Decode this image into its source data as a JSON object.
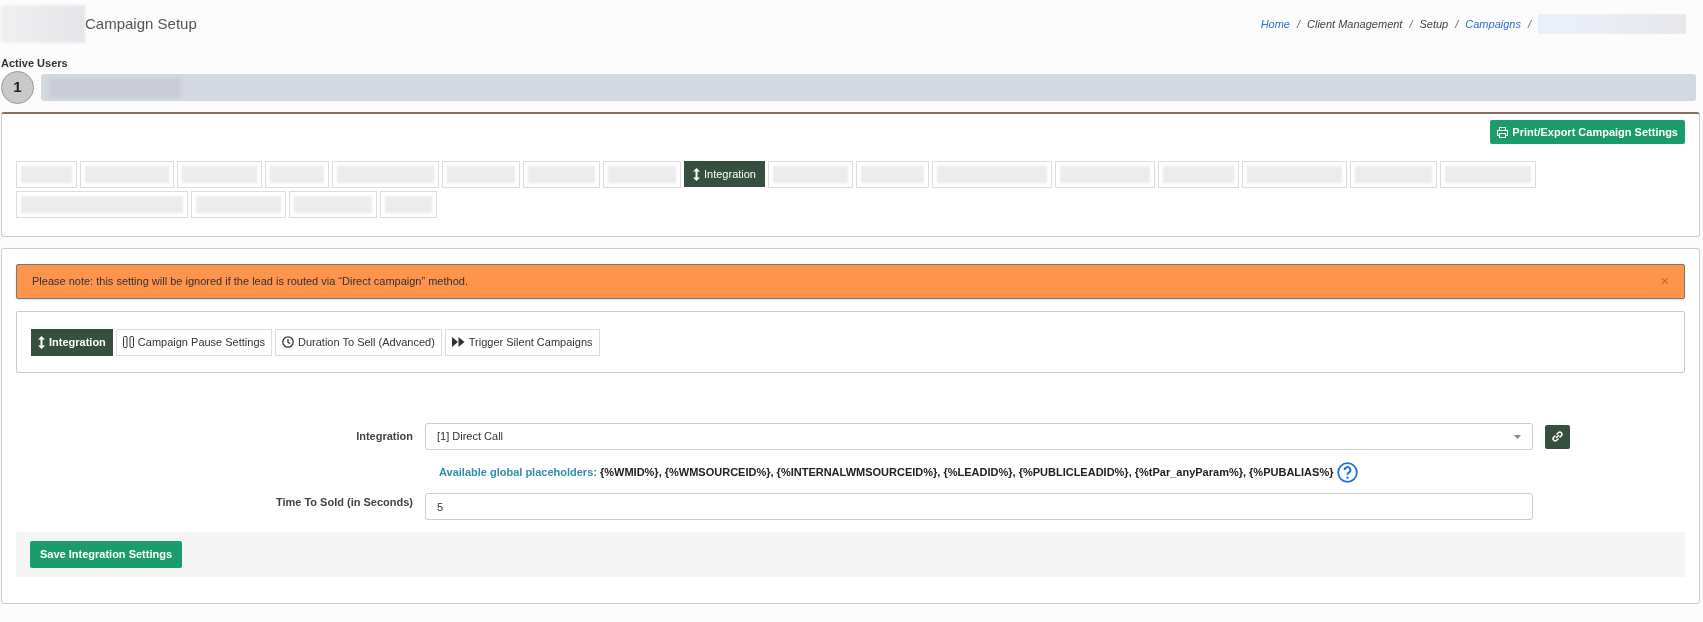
{
  "page": {
    "title": "Campaign Setup"
  },
  "breadcrumb": [
    {
      "label": "Home",
      "link": true,
      "separator": "/"
    },
    {
      "label": "Client Management",
      "link": false,
      "separator": "/"
    },
    {
      "label": "Setup",
      "link": false,
      "separator": "/"
    },
    {
      "label": "Campaigns",
      "link": true,
      "separator": "/"
    }
  ],
  "active_users": {
    "label": "Active Users",
    "count": "1"
  },
  "print_button": "Print/Export Campaign Settings",
  "campaign_tabs": [
    {
      "kind": "redacted",
      "selected": false
    },
    {
      "kind": "redacted",
      "selected": false
    },
    {
      "kind": "redacted",
      "selected": false
    },
    {
      "kind": "redacted",
      "selected": false
    },
    {
      "kind": "redacted",
      "selected": false
    },
    {
      "kind": "redacted",
      "selected": false
    },
    {
      "kind": "redacted",
      "selected": false
    },
    {
      "kind": "redacted",
      "selected": false
    },
    {
      "kind": "labeled",
      "label": "Integration",
      "selected": true
    },
    {
      "kind": "redacted",
      "selected": false
    },
    {
      "kind": "redacted",
      "selected": false
    },
    {
      "kind": "redacted",
      "selected": false
    },
    {
      "kind": "redacted",
      "selected": false
    },
    {
      "kind": "redacted",
      "selected": false
    },
    {
      "kind": "redacted",
      "selected": false
    },
    {
      "kind": "redacted",
      "selected": false
    },
    {
      "kind": "redacted",
      "selected": false
    },
    {
      "kind": "redacted",
      "selected": false
    },
    {
      "kind": "redacted",
      "selected": false
    },
    {
      "kind": "redacted",
      "selected": false
    },
    {
      "kind": "redacted",
      "selected": false
    }
  ],
  "alert": {
    "text": "Please note: this setting will be ignored if the lead is routed via “Direct campaign” method.",
    "close": "×"
  },
  "sub_tabs": [
    {
      "kind": "updown",
      "label": "Integration",
      "selected": true
    },
    {
      "kind": "pause",
      "label": "Campaign Pause Settings",
      "selected": false
    },
    {
      "kind": "clock",
      "label": "Duration To Sell (Advanced)",
      "selected": false
    },
    {
      "kind": "forward",
      "label": "Trigger Silent Campaigns",
      "selected": false
    }
  ],
  "form": {
    "integration": {
      "label": "Integration",
      "value": "[1] Direct Call"
    },
    "placeholders": {
      "label": "Available global placeholders:",
      "text": "{%WMID%}, {%WMSOURCEID%}, {%INTERNALWMSOURCEID%}, {%LEADID%}, {%PUBLICLEADID%}, {%tPar_anyParam%}, {%PUBALIAS%}"
    },
    "time_to_sold": {
      "label": "Time To Sold (in Seconds)",
      "value": "5"
    }
  },
  "save_button": "Save Integration Settings"
}
